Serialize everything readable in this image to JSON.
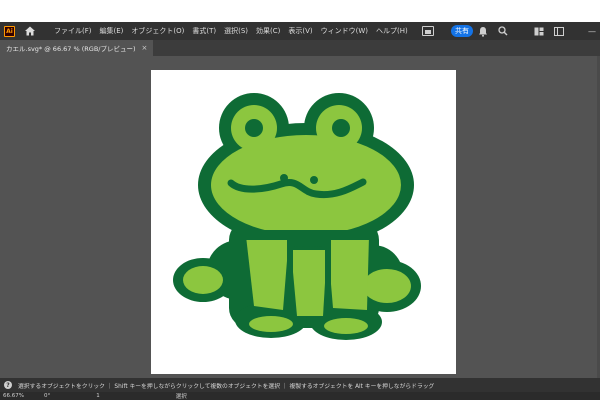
{
  "app": {
    "logo": "Ai"
  },
  "menu": {
    "items": [
      "ファイル(F)",
      "編集(E)",
      "オブジェクト(O)",
      "書式(T)",
      "選択(S)",
      "効果(C)",
      "表示(V)",
      "ウィンドウ(W)",
      "ヘルプ(H)"
    ]
  },
  "toolbar": {
    "share_label": "共有"
  },
  "window_controls": {
    "minimize": "—",
    "maximize": "▢",
    "close": "✕"
  },
  "tabs": [
    {
      "label": "カエル.svg* @ 66.67 % (RGB/プレビュー)",
      "close": "×"
    }
  ],
  "status": {
    "help_glyph": "?",
    "message": "選択するオブジェクトをクリック ｜ Shift キーを押しながらクリックして複数のオブジェクトを選択 ｜ 複製するオブジェクトを Alt キーを押しながらドラッグ"
  },
  "bottom": {
    "zoom": "66.67%",
    "rotation": "0°",
    "artboard_index": "1",
    "tool_label": "選択"
  },
  "colors": {
    "frog_outline": "#0e6b35",
    "frog_fill": "#8cc63f",
    "accent": "#1473e6"
  },
  "icons": [
    "home-icon",
    "arrange-documents-icon",
    "notification-bell-icon",
    "search-icon",
    "workspace-icon",
    "panel-icon"
  ]
}
